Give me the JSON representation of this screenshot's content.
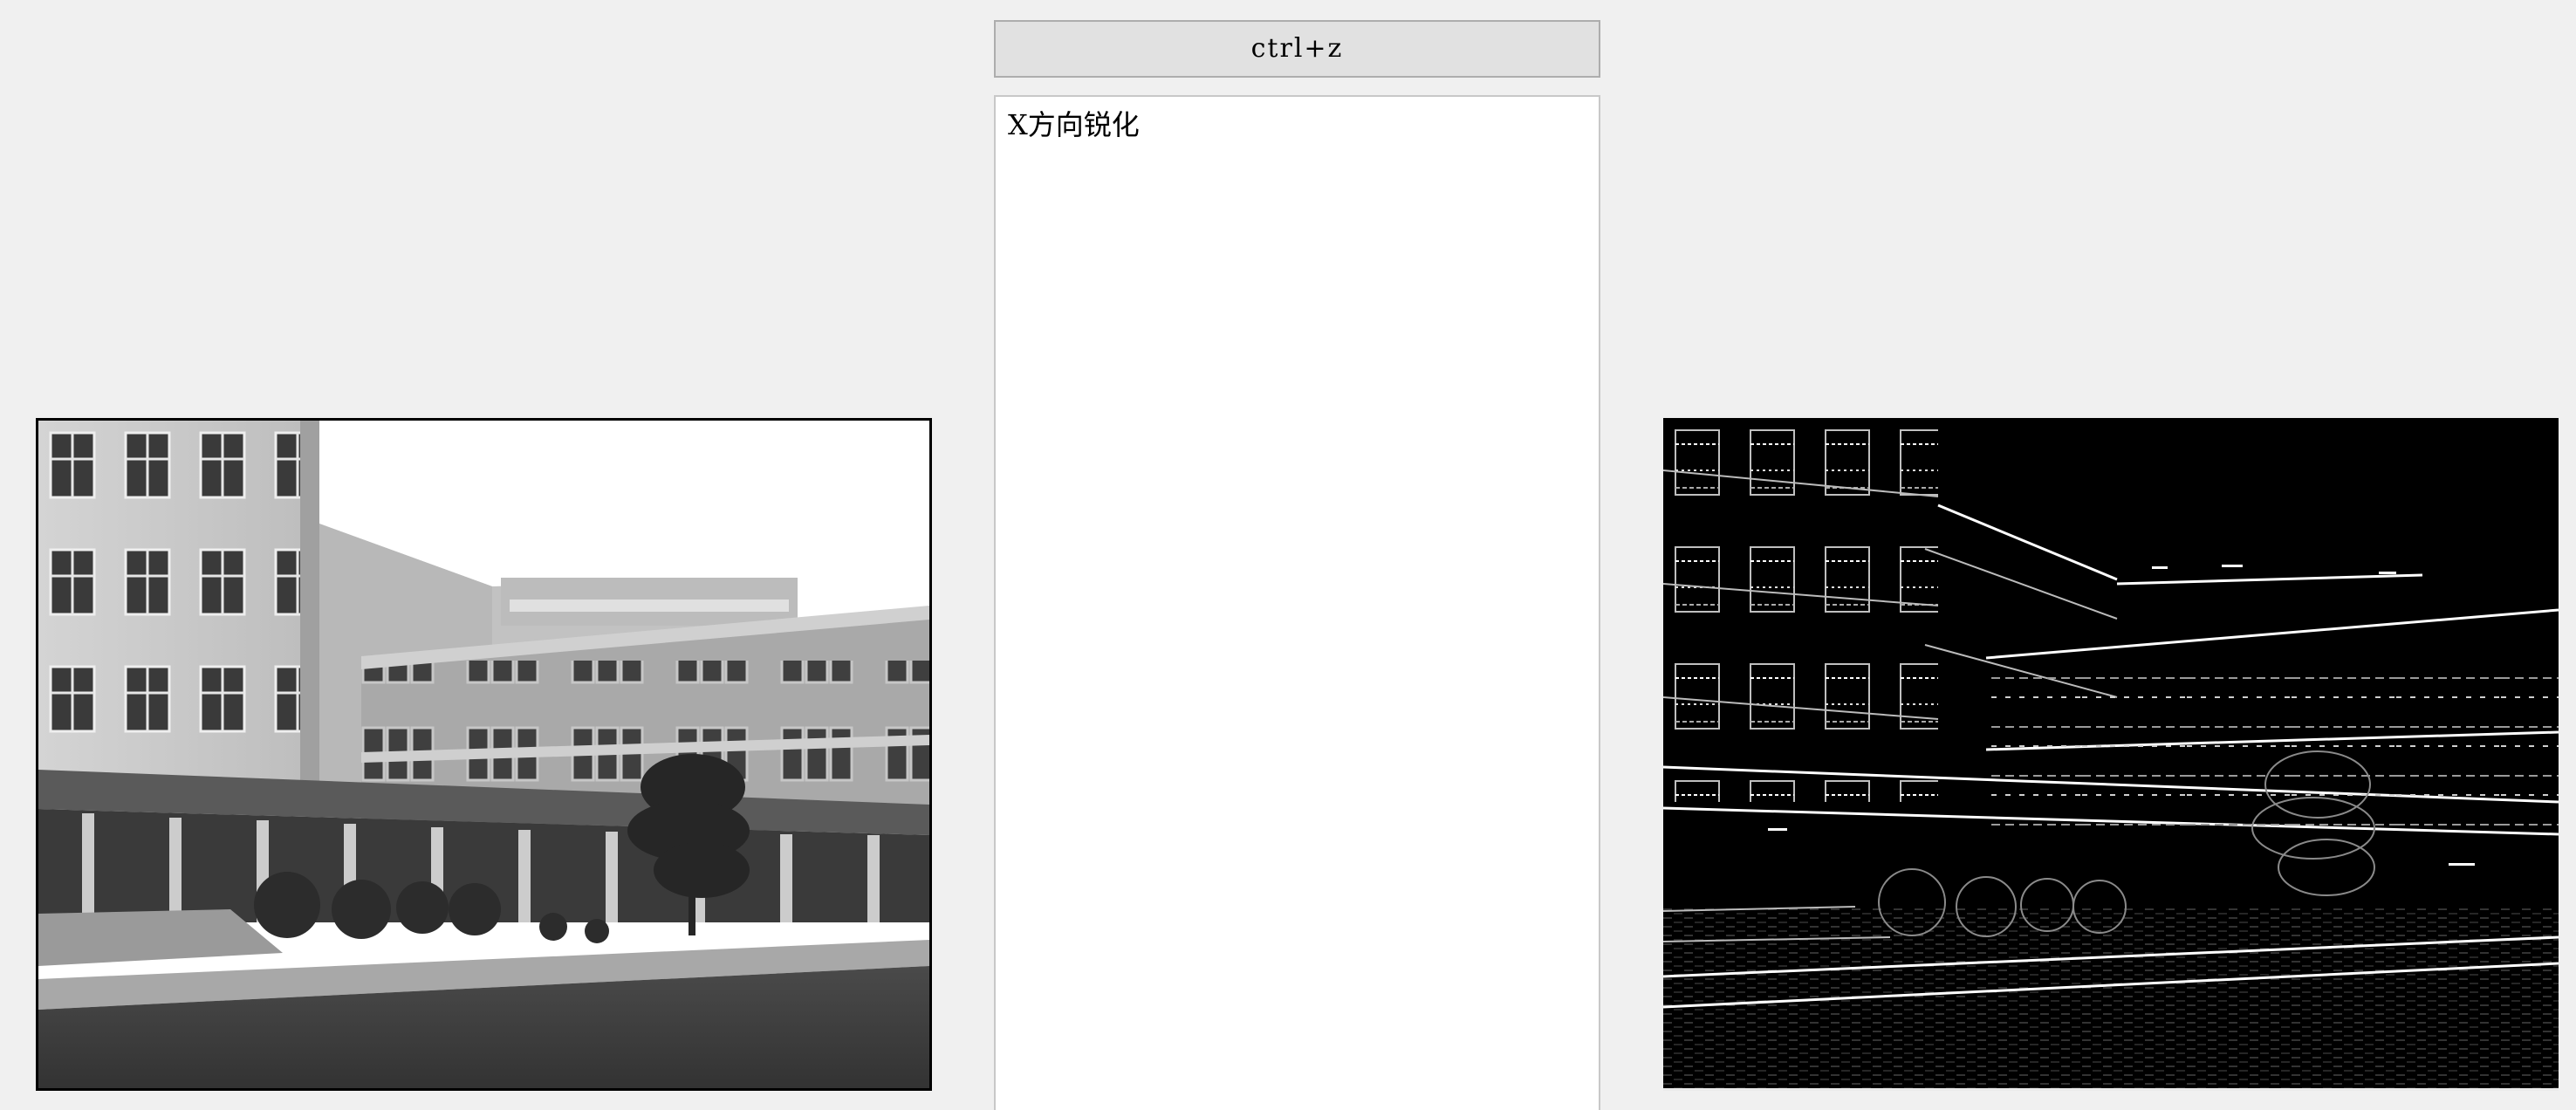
{
  "toolbar": {
    "undo_label": "ctrl+z"
  },
  "history": {
    "items": [
      "X方向锐化"
    ]
  },
  "colors": {
    "window_bg": "#f0f0f0",
    "button_bg": "#e1e1e1",
    "button_border": "#adadad",
    "list_bg": "#ffffff",
    "list_border": "#c8c8c8"
  },
  "images": {
    "original": {
      "icon": "grayscale-building-photo"
    },
    "result": {
      "icon": "x-sobel-edge-image"
    }
  }
}
